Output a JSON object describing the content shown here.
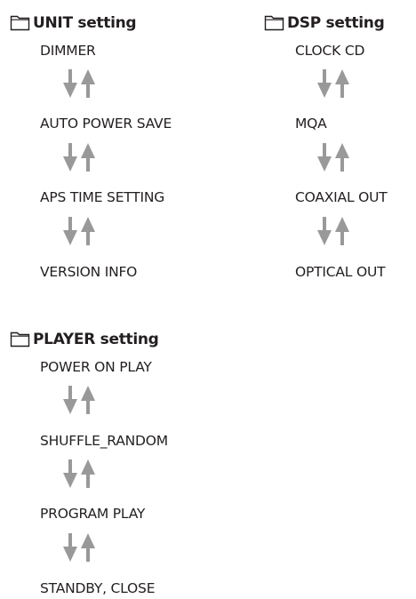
{
  "colors": {
    "text": "#231f20",
    "arrow": "#999999"
  },
  "arrow_icon": "down-up-arrows-icon",
  "folder_icon": "folder-icon",
  "groups": {
    "unit": {
      "title": "UNIT setting",
      "items": [
        "DIMMER",
        "AUTO POWER SAVE",
        "APS TIME SETTING",
        "VERSION INFO"
      ]
    },
    "dsp": {
      "title": "DSP setting",
      "items": [
        "CLOCK CD",
        "MQA",
        "COAXIAL OUT",
        "OPTICAL OUT"
      ]
    },
    "player": {
      "title": "PLAYER setting",
      "items": [
        "POWER ON PLAY",
        "SHUFFLE_RANDOM",
        "PROGRAM PLAY",
        "STANDBY, CLOSE"
      ]
    }
  }
}
